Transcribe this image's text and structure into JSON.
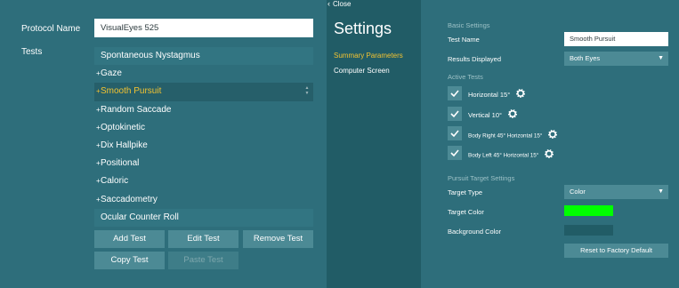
{
  "left": {
    "protocol_label": "Protocol Name",
    "protocol_value": "VisualEyes 525",
    "tests_label": "Tests",
    "tests": [
      {
        "label": "Spontaneous Nystagmus",
        "expandable": false
      },
      {
        "label": "Gaze",
        "expandable": true
      },
      {
        "label": "Smooth Pursuit",
        "expandable": true,
        "selected": true
      },
      {
        "label": "Random Saccade",
        "expandable": true
      },
      {
        "label": "Optokinetic",
        "expandable": true
      },
      {
        "label": "Dix Hallpike",
        "expandable": true
      },
      {
        "label": "Positional",
        "expandable": true
      },
      {
        "label": "Caloric",
        "expandable": true
      },
      {
        "label": "Saccadometry",
        "expandable": true
      },
      {
        "label": "Ocular Counter Roll",
        "expandable": false
      }
    ],
    "plus_symbol": "+",
    "buttons": {
      "add": "Add Test",
      "edit": "Edit Test",
      "remove": "Remove Test",
      "copy": "Copy Test",
      "paste": "Paste Test"
    }
  },
  "middle": {
    "close_label": "Close",
    "title": "Settings",
    "nav": [
      {
        "label": "Summary Parameters",
        "active": true
      },
      {
        "label": "Computer Screen",
        "active": false
      }
    ]
  },
  "right": {
    "basic_settings": "Basic Settings",
    "test_name_label": "Test Name",
    "test_name_value": "Smooth Pursuit",
    "results_label": "Results Displayed",
    "results_value": "Both Eyes",
    "active_tests": "Active Tests",
    "active_items": [
      {
        "label": "Horizontal 15°",
        "checked": true
      },
      {
        "label": "Vertical 10°",
        "checked": true
      },
      {
        "label": "Body Right 45° Horizontal 15°",
        "checked": true
      },
      {
        "label": "Body Left 45° Horizontal 15°",
        "checked": true
      }
    ],
    "pursuit_settings": "Pursuit Target Settings",
    "target_type_label": "Target Type",
    "target_type_value": "Color",
    "target_color_label": "Target Color",
    "background_color_label": "Background Color",
    "reset_label": "Reset to Factory Default"
  },
  "colors": {
    "target_color": "#00ff00",
    "background_color": "#215c66",
    "accent": "#f3c331",
    "panel": "#2e6e7b"
  },
  "icons": {
    "close": "chevron-left-icon",
    "checkbox": "checkmark-icon",
    "settings": "gear-icon",
    "dropdown": "triangle-down-icon",
    "scroll": "up-down-arrows-icon"
  }
}
